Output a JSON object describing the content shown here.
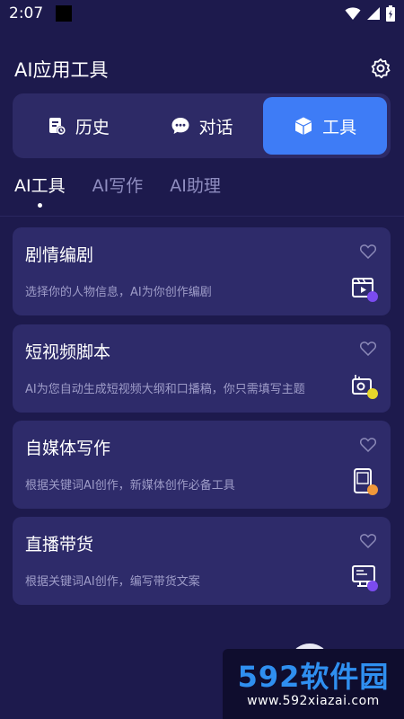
{
  "status_bar": {
    "time": "2:07"
  },
  "header": {
    "title": "AI应用工具",
    "settings_icon": "gear-icon"
  },
  "segment": {
    "items": [
      {
        "label": "历史",
        "icon": "history-document-icon",
        "active": false
      },
      {
        "label": "对话",
        "icon": "chat-bubble-icon",
        "active": false
      },
      {
        "label": "工具",
        "icon": "cube-icon",
        "active": true
      }
    ]
  },
  "subtabs": [
    {
      "label": "AI工具",
      "active": true
    },
    {
      "label": "AI写作",
      "active": false
    },
    {
      "label": "AI助理",
      "active": false
    }
  ],
  "cards": [
    {
      "title": "剧情编剧",
      "desc": "选择你的人物信息，AI为你创作编剧",
      "icon": "video-script-icon"
    },
    {
      "title": "短视频脚本",
      "desc": "AI为您自动生成短视频大纲和口播稿，你只需填写主题",
      "icon": "camera-icon"
    },
    {
      "title": "自媒体写作",
      "desc": "根据关键词AI创作，新媒体创作必备工具",
      "icon": "tablet-icon"
    },
    {
      "title": "直播带货",
      "desc": "根据关键词AI创作，编写带货文案",
      "icon": "monitor-icon"
    }
  ],
  "watermark": {
    "logo": "592软件园",
    "url": "www.592xiazai.com"
  },
  "colors": {
    "background": "#1d1a4d",
    "card": "#2e2b6a",
    "accent": "#3e7cf6"
  }
}
